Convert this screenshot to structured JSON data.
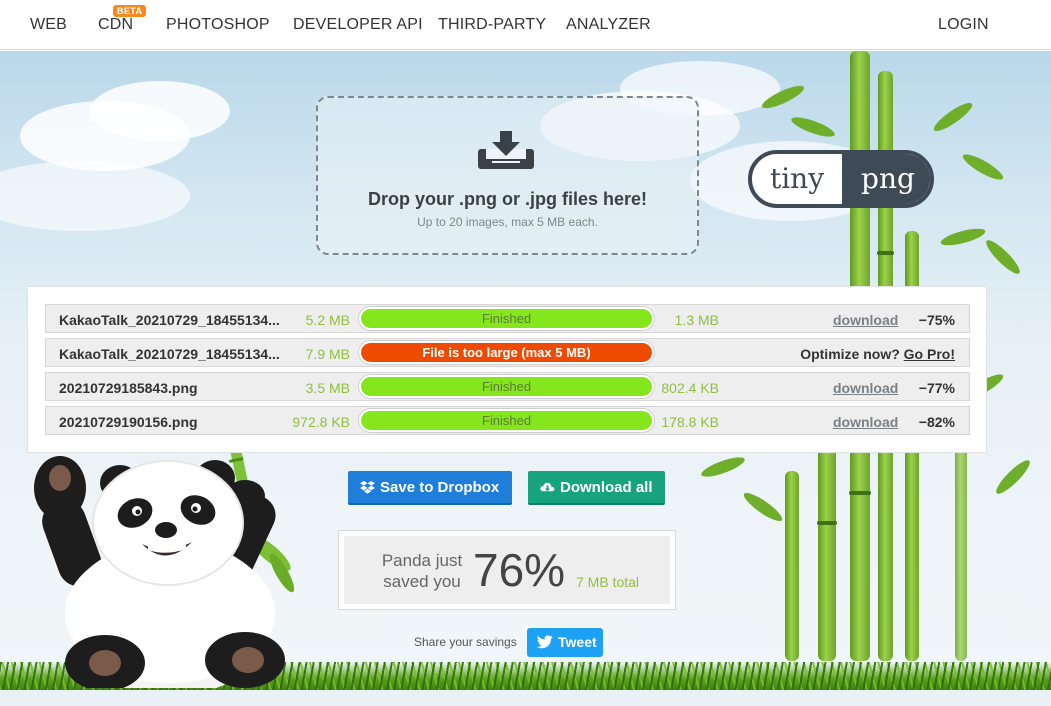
{
  "nav": {
    "items": [
      "WEB",
      "CDN",
      "PHOTOSHOP",
      "DEVELOPER API",
      "THIRD-PARTY",
      "ANALYZER"
    ],
    "badge": "BETA",
    "login": "LOGIN"
  },
  "dropzone": {
    "title": "Drop your .png or .jpg files here!",
    "subtitle": "Up to 20 images, max 5 MB each.",
    "icon": "download-tray-icon"
  },
  "logo": {
    "left": "tiny",
    "right": "png"
  },
  "files": [
    {
      "name": "KakaoTalk_20210729_18455134...",
      "size_in": "5.2 MB",
      "status": "Finished",
      "state": "ok",
      "progress": 1.0,
      "size_out": "1.3 MB",
      "link": "download",
      "saving": "−75%"
    },
    {
      "name": "KakaoTalk_20210729_18455134...",
      "size_in": "7.9 MB",
      "status": "File is too large (max 5 MB)",
      "state": "error",
      "progress": 1.0,
      "optimize_text": "Optimize now?",
      "optimize_link": "Go Pro!"
    },
    {
      "name": "20210729185843.png",
      "size_in": "3.5 MB",
      "status": "Finished",
      "state": "ok",
      "progress": 1.0,
      "size_out": "802.4 KB",
      "link": "download",
      "saving": "−77%"
    },
    {
      "name": "20210729190156.png",
      "size_in": "972.8 KB",
      "status": "Finished",
      "state": "ok",
      "progress": 1.0,
      "size_out": "178.8 KB",
      "link": "download",
      "saving": "−82%"
    }
  ],
  "actions": {
    "dropbox_label": "Save to Dropbox",
    "dropbox_icon": "dropbox-icon",
    "download_all_label": "Download all",
    "download_all_icon": "cloud-download-icon"
  },
  "savings": {
    "line1": "Panda just",
    "line2": "saved you",
    "percent": "76%",
    "total": "7 MB total"
  },
  "share": {
    "label": "Share your savings",
    "tweet": "Tweet",
    "tweet_icon": "twitter-bird-icon"
  },
  "colors": {
    "finished_bar": "#86e61e",
    "error_bar": "#ee4a00",
    "size_text": "#8fbf3f",
    "dropbox_button": "#1f7ed9",
    "download_all_button": "#17a37c",
    "tweet_button": "#1da1f2",
    "beta_badge": "#f58a1f"
  }
}
